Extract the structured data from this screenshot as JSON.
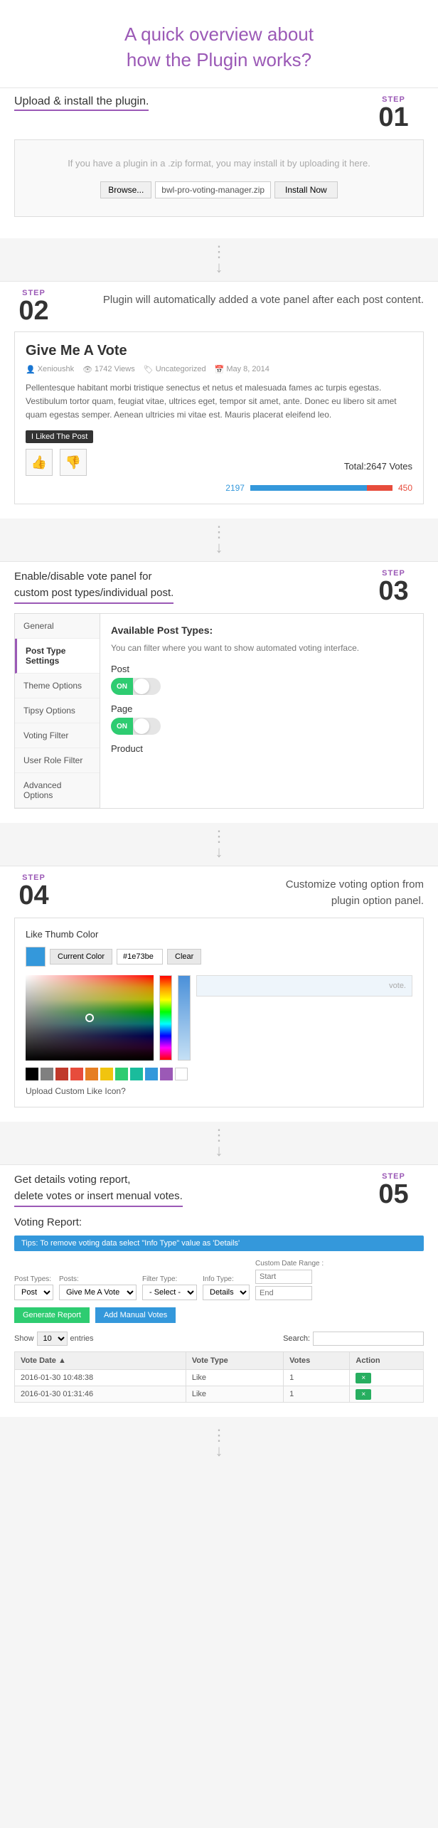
{
  "header": {
    "title_line1": "A quick overview about",
    "title_line2_before": "how the ",
    "title_line2_highlight": "Plugin",
    "title_line2_after": " works?"
  },
  "step01": {
    "step_label": "STEP",
    "step_num": "01",
    "title": "Upload & install the plugin.",
    "upload_hint": "If you have a plugin in a .zip format, you may install it by uploading it here.",
    "browse_label": "Browse...",
    "file_name": "bwl-pro-voting-manager.zip",
    "install_label": "Install Now"
  },
  "step02": {
    "step_label": "STEP",
    "step_num": "02",
    "desc": "Plugin will automatically added a vote panel after each post content.",
    "card": {
      "title": "Give Me A Vote",
      "author": "Xenioushk",
      "views": "1742 Views",
      "category": "Uncategorized",
      "date": "May 8, 2014",
      "body": "Pellentesque habitant morbi tristique senectus et netus et malesuada fames ac turpis egestas. Vestibulum tortor quam, feugiat vitae, ultrices eget, tempor sit amet, ante. Donec eu libero sit amet quam egestas semper. Aenean ultricies mi vitae est. Mauris placerat eleifend leo.",
      "tooltip": "I Liked The Post",
      "total_votes": "Total:2647 Votes",
      "count_up": "2197",
      "count_down": "450"
    }
  },
  "step03": {
    "step_label": "STEP",
    "step_num": "03",
    "desc_line1": "Enable/disable vote panel for",
    "desc_line2": "custom post types/individual post.",
    "panel": {
      "title": "Available Post Types:",
      "hint": "You can filter where you want to show automated voting interface.",
      "sidebar_items": [
        "General",
        "Post Type Settings",
        "Theme Options",
        "Tipsy Options",
        "Voting Filter",
        "User Role Filter",
        "Advanced Options"
      ],
      "active_item": "Post Type Settings",
      "post_label": "Post",
      "page_label": "Page",
      "product_label": "Product",
      "toggle_on": "ON"
    }
  },
  "step04": {
    "step_label": "STEP",
    "step_num": "04",
    "desc_line1": "Customize voting option from",
    "desc_line2": "plugin option panel.",
    "panel": {
      "title": "Like Thumb Color",
      "current_color_label": "Current Color",
      "hex_value": "#1e73be",
      "clear_label": "Clear",
      "upload_label": "Upload Custom Like Icon?",
      "vote_text": "vote.",
      "swatches": [
        "#000000",
        "#808080",
        "#c0392b",
        "#e74c3c",
        "#e67e22",
        "#f1c40f",
        "#2ecc71",
        "#1abc9c",
        "#3498db",
        "#9b59b6",
        "#ffffff"
      ]
    }
  },
  "step05": {
    "step_label": "STEP",
    "step_num": "05",
    "desc_line1": "Get details voting report,",
    "desc_line2": "delete votes or insert menual votes.",
    "report_title": "Voting Report:",
    "tips": "Tips: To remove voting data select \"Info Type\" value as 'Details'",
    "filter": {
      "post_types_label": "Post Types:",
      "posts_label": "Posts:",
      "filter_type_label": "Filter Type:",
      "info_type_label": "Info Type:",
      "date_range_label": "Custom Date Range :",
      "post_type_value": "Post",
      "posts_value": "Give Me A Vote",
      "filter_options": [
        "- Select -"
      ],
      "info_options": [
        "Details"
      ],
      "start_label": "Start",
      "end_label": "End"
    },
    "generate_btn": "Generate Report",
    "manual_votes_btn": "Add Manual Votes",
    "show_label": "Show",
    "entries_label": "entries",
    "search_label": "Search:",
    "table": {
      "headers": [
        "Vote Date",
        "Vote Type",
        "Votes",
        "Action"
      ],
      "rows": [
        {
          "date": "2016-01-30 10:48:38",
          "type": "Like",
          "votes": "1",
          "action": "×"
        },
        {
          "date": "2016-01-30 01:31:46",
          "type": "Like",
          "votes": "1",
          "action": "×"
        }
      ]
    },
    "show_count": "10"
  }
}
